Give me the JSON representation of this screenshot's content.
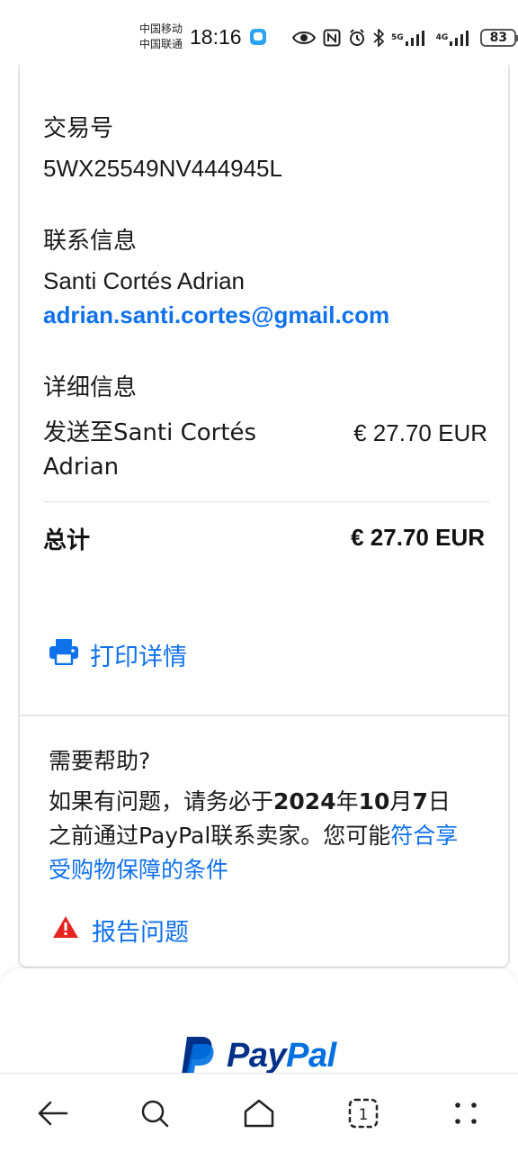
{
  "status_bar": {
    "carrier_1": "中国移动",
    "carrier_2": "中国联通",
    "time": "18:16",
    "network_1": "5G",
    "network_2": "4G",
    "battery": "83"
  },
  "transaction": {
    "id_label": "交易号",
    "id_value": "5WX25549NV444945L",
    "contact_label": "联系信息",
    "contact_name": "Santi Cortés Adrian",
    "contact_email": "adrian.santi.cortes@gmail.com",
    "details_label": "详细信息",
    "line_item_desc": "发送至Santi Cortés Adrian",
    "line_item_amount": "€ 27.70 EUR",
    "total_label": "总计",
    "total_amount": "€ 27.70 EUR"
  },
  "actions": {
    "print_label": "打印详情"
  },
  "help": {
    "title": "需要帮助?",
    "text_1": "如果有问题，请务必于",
    "date_1": "2024",
    "text_2": "年",
    "date_2": "10",
    "text_3": "月",
    "date_3": "7",
    "text_4": "日之前通过PayPal联系卖家。您可能",
    "link": "符合享受购物保障的条件",
    "report_label": "报告问题"
  },
  "footer": {
    "brand": "PayPal",
    "brand_part_1": "Pay",
    "brand_part_2": "Pal"
  },
  "colors": {
    "link_blue": "#1072eb",
    "paypal_navy": "#003087",
    "warning_red": "#e52521"
  },
  "icons": [
    "print-icon",
    "warning-icon",
    "back-icon",
    "search-icon",
    "home-icon",
    "tabs-icon",
    "menu-icon"
  ]
}
